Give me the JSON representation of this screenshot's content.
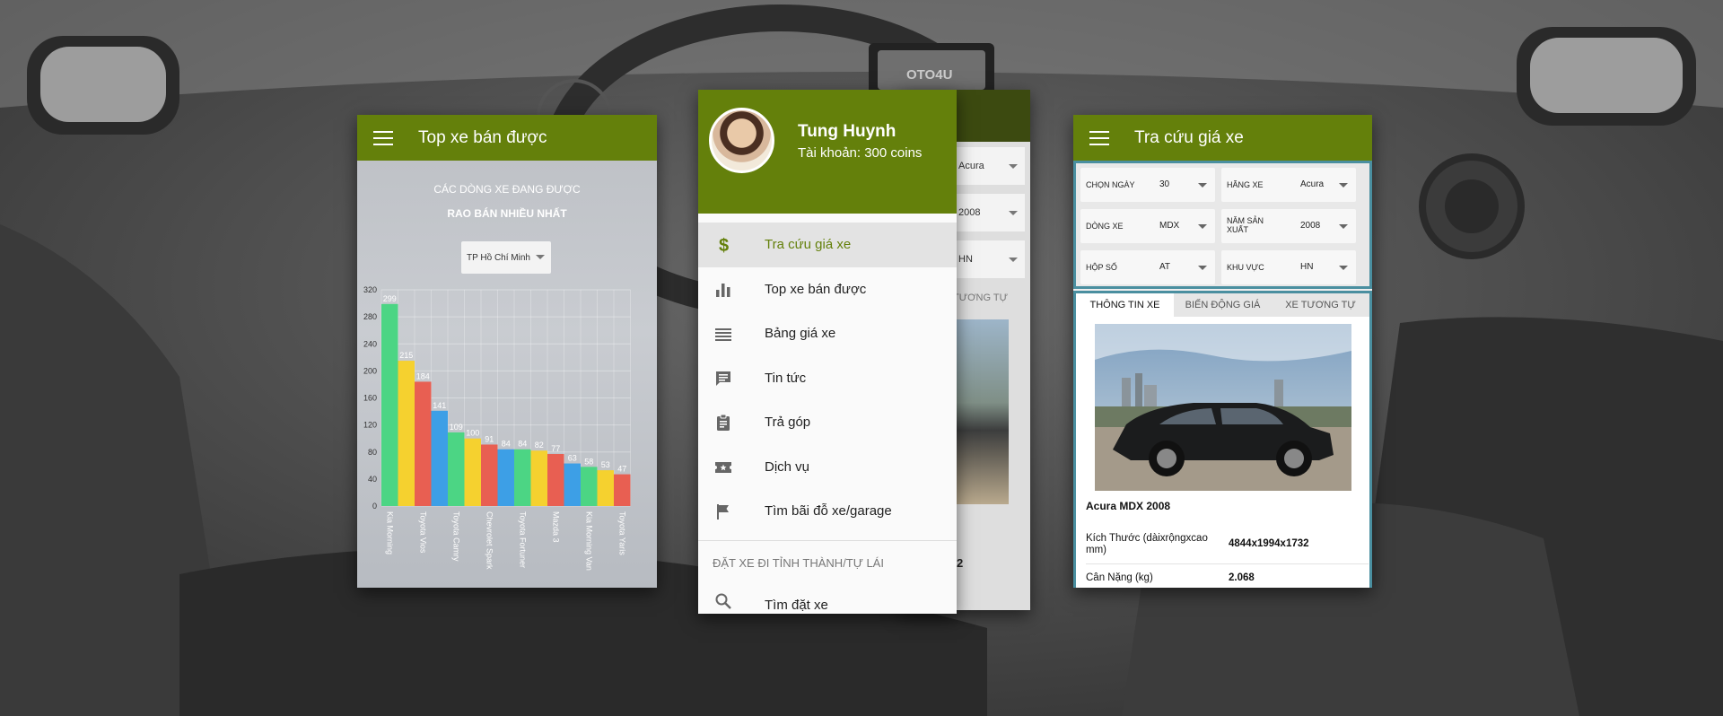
{
  "screen_left": {
    "title": "Top xe bán được",
    "heading_line1": "CÁC DÒNG XE ĐANG ĐƯỢC",
    "heading_line2": "RAO BÁN NHIỀU NHẤT",
    "city_select": "TP Hồ Chí Minh"
  },
  "chart_data": {
    "type": "bar",
    "categories": [
      "Kia Morning",
      "",
      "Toyota Vios",
      "",
      "Toyota Camry",
      "",
      "Chevrolet Spark",
      "",
      "Toyota Fortuner",
      "",
      "Mazda 3",
      "",
      "Kia Morning Van",
      "",
      "Toyota Yaris"
    ],
    "values": [
      299,
      215,
      184,
      141,
      109,
      100,
      91,
      84,
      84,
      82,
      77,
      63,
      58,
      53,
      47
    ],
    "colors": [
      "#4cd584",
      "#f5d12f",
      "#e85f52",
      "#3d9fe6",
      "#4cd584",
      "#f5d12f",
      "#e85f52",
      "#3d9fe6",
      "#4cd584",
      "#f5d12f",
      "#e85f52",
      "#3d9fe6",
      "#4cd584",
      "#f5d12f",
      "#e85f52"
    ],
    "yticks": [
      0,
      40,
      80,
      120,
      160,
      200,
      240,
      280,
      320
    ],
    "ylim": [
      0,
      320
    ],
    "grid": true
  },
  "drawer": {
    "user_name": "Tung Huynh",
    "user_coins": "Tài khoản: 300 coins",
    "items": [
      {
        "label": "Tra cứu giá xe",
        "icon": "dollar-icon"
      },
      {
        "label": "Top xe bán được",
        "icon": "bar-chart-icon"
      },
      {
        "label": "Bảng giá xe",
        "icon": "list-icon"
      },
      {
        "label": "Tin tức",
        "icon": "message-icon"
      },
      {
        "label": "Trả góp",
        "icon": "clipboard-icon"
      },
      {
        "label": "Dịch vụ",
        "icon": "ticket-icon"
      },
      {
        "label": "Tìm bãi đỗ xe/garage",
        "icon": "flag-icon"
      }
    ],
    "section": "ĐẶT XE ĐI TỈNH THÀNH/TỰ LÁI",
    "search_label": "Tìm đặt xe",
    "behind": {
      "v1": "Acura",
      "v2": "2008",
      "v3": "HN",
      "tab": "TƯƠNG TỰ",
      "num": "2"
    }
  },
  "screen_right": {
    "title": "Tra cứu giá xe",
    "filters": [
      {
        "label": "CHỌN NGÀY",
        "value": "30"
      },
      {
        "label": "HÃNG XE",
        "value": "Acura"
      },
      {
        "label": "DÒNG XE",
        "value": "MDX"
      },
      {
        "label": "NĂM SẢN XUẤT",
        "value": "2008"
      },
      {
        "label": "HỘP SỐ",
        "value": "AT"
      },
      {
        "label": "KHU VỰC",
        "value": "HN"
      }
    ],
    "tabs": [
      "THÔNG TIN XE",
      "BIẾN ĐỘNG GIÁ",
      "XE TƯƠNG TỰ"
    ],
    "model": "Acura MDX 2008",
    "specs": [
      {
        "k": "Kích Thước (dàixrộngxcao mm)",
        "v": "4844x1994x1732"
      },
      {
        "k": "Cân Nặng (kg)",
        "v": "2.068"
      }
    ]
  },
  "dashboard_logo": "OTO4U"
}
